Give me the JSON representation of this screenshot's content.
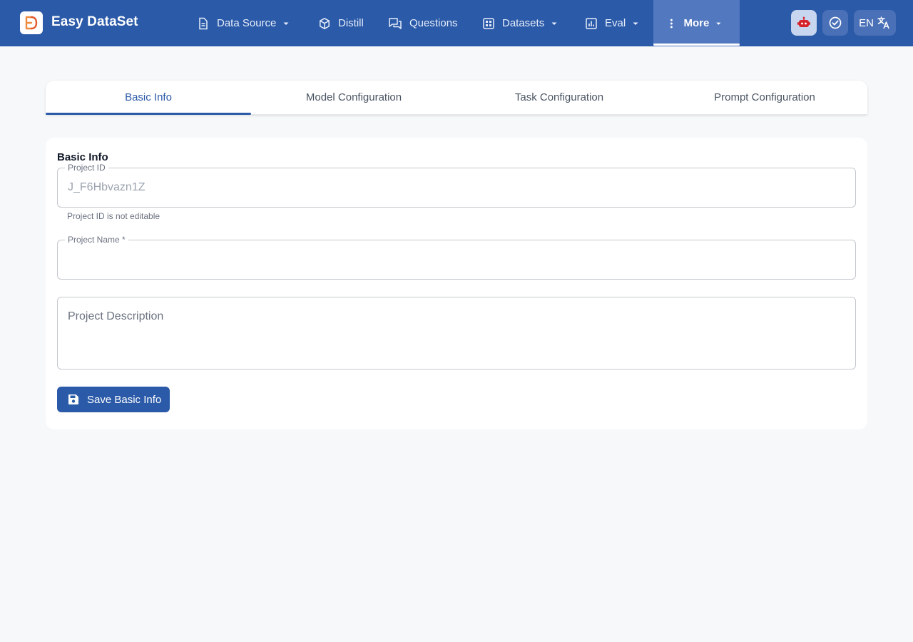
{
  "app": {
    "name": "Easy DataSet"
  },
  "nav": {
    "data_source": "Data Source",
    "distill": "Distill",
    "questions": "Questions",
    "datasets": "Datasets",
    "eval": "Eval",
    "more": "More"
  },
  "header": {
    "language": "EN"
  },
  "tabs": [
    {
      "label": "Basic Info"
    },
    {
      "label": "Model Configuration"
    },
    {
      "label": "Task Configuration"
    },
    {
      "label": "Prompt Configuration"
    }
  ],
  "basic_info": {
    "title": "Basic Info",
    "project_id_label": "Project ID",
    "project_id_value": "J_F6Hbvazn1Z",
    "project_id_helper": "Project ID is not editable",
    "project_name_label": "Project Name *",
    "project_name_value": "",
    "project_description_placeholder": "Project Description",
    "save_label": "Save Basic Info"
  },
  "colors": {
    "primary": "#2b5aa8",
    "more_active": "#5278c0",
    "page_bg": "#f6f8fa"
  }
}
